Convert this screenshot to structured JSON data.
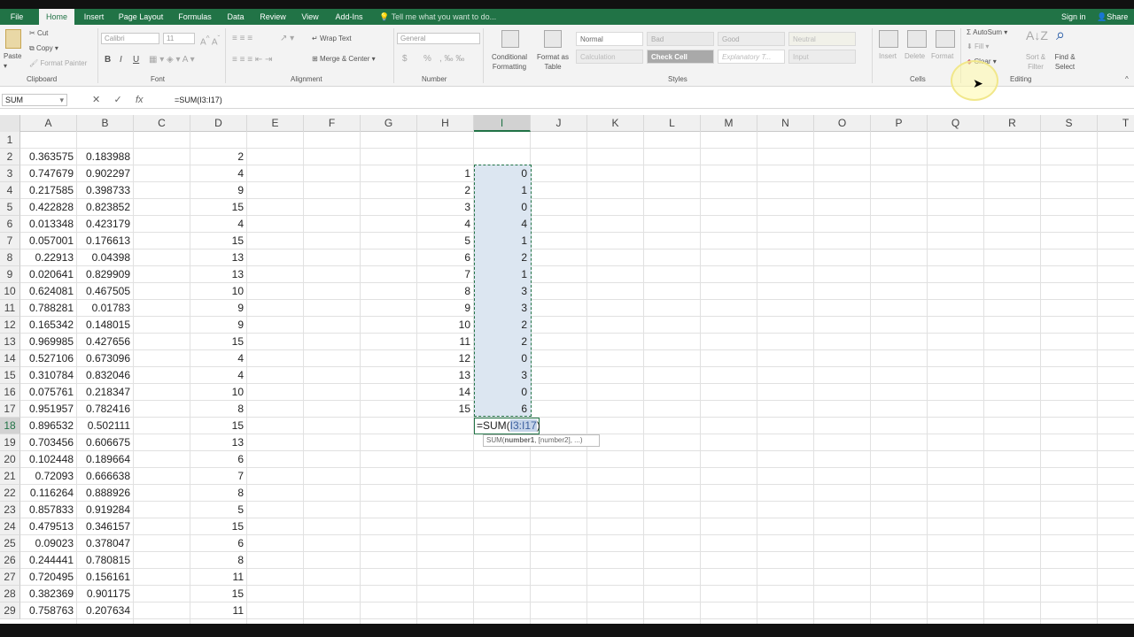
{
  "tabs": [
    "File",
    "Home",
    "Insert",
    "Page Layout",
    "Formulas",
    "Data",
    "Review",
    "View",
    "Add-Ins"
  ],
  "tell_me": "Tell me what you want to do...",
  "account": {
    "signin": "Sign in",
    "share": "Share"
  },
  "ribbon": {
    "clipboard": {
      "paste": "Paste",
      "cut": "Cut",
      "copy": "Copy",
      "format_painter": "Format Painter",
      "group": "Clipboard"
    },
    "font": {
      "name": "Calibri",
      "size": "11",
      "bold": "B",
      "italic": "I",
      "underline": "U",
      "group": "Font"
    },
    "alignment": {
      "wrap": "Wrap Text",
      "merge": "Merge & Center",
      "group": "Alignment"
    },
    "number": {
      "format": "General",
      "currency": "$",
      "percent": "%",
      "group": "Number"
    },
    "styles": {
      "conditional": "Conditional Formatting",
      "format_table": "Format as Table",
      "normal": "Normal",
      "bad": "Bad",
      "good": "Good",
      "neutral": "Neutral",
      "calculation": "Calculation",
      "check": "Check Cell",
      "explanatory": "Explanatory T...",
      "input": "Input",
      "group": "Styles"
    },
    "cells": {
      "insert": "Insert",
      "delete": "Delete",
      "format": "Format",
      "group": "Cells"
    },
    "editing": {
      "autosum": "AutoSum",
      "fill": "Fill",
      "clear": "Clear",
      "sort": "Sort & Filter",
      "find": "Find & Select",
      "group": "Editing"
    }
  },
  "formula_bar": {
    "name_box": "SUM",
    "formula": "=SUM(I3:I17)",
    "x": "✕",
    "check": "✓",
    "fx": "fx"
  },
  "columns": [
    "A",
    "B",
    "C",
    "D",
    "E",
    "F",
    "G",
    "H",
    "I",
    "J",
    "K",
    "L",
    "M",
    "N",
    "O",
    "P",
    "Q",
    "R",
    "S",
    "T"
  ],
  "rows": [
    1,
    2,
    3,
    4,
    5,
    6,
    7,
    8,
    9,
    10,
    11,
    12,
    13,
    14,
    15,
    16,
    17,
    18,
    19,
    20,
    21,
    22,
    23,
    24,
    25,
    26,
    27,
    28,
    29
  ],
  "col_a": [
    "",
    "0.363575",
    "0.747679",
    "0.217585",
    "0.422828",
    "0.013348",
    "0.057001",
    "0.22913",
    "0.020641",
    "0.624081",
    "0.788281",
    "0.165342",
    "0.969985",
    "0.527106",
    "0.310784",
    "0.075761",
    "0.951957",
    "0.896532",
    "0.703456",
    "0.102448",
    "0.72093",
    "0.116264",
    "0.857833",
    "0.479513",
    "0.09023",
    "0.244441",
    "0.720495",
    "0.382369",
    "0.758763"
  ],
  "col_b": [
    "",
    "0.183988",
    "0.902297",
    "0.398733",
    "0.823852",
    "0.423179",
    "0.176613",
    "0.04398",
    "0.829909",
    "0.467505",
    "0.01783",
    "0.148015",
    "0.427656",
    "0.673096",
    "0.832046",
    "0.218347",
    "0.782416",
    "0.502111",
    "0.606675",
    "0.189664",
    "0.666638",
    "0.888926",
    "0.919284",
    "0.346157",
    "0.378047",
    "0.780815",
    "0.156161",
    "0.901175",
    "0.207634"
  ],
  "col_d": [
    "",
    "2",
    "4",
    "9",
    "15",
    "4",
    "15",
    "13",
    "13",
    "10",
    "9",
    "9",
    "15",
    "4",
    "4",
    "10",
    "8",
    "15",
    "13",
    "6",
    "7",
    "8",
    "5",
    "15",
    "6",
    "8",
    "11",
    "15",
    "11"
  ],
  "col_h": [
    "",
    "",
    "1",
    "2",
    "3",
    "4",
    "5",
    "6",
    "7",
    "8",
    "9",
    "10",
    "11",
    "12",
    "13",
    "14",
    "15"
  ],
  "col_i": [
    "",
    "",
    "0",
    "1",
    "0",
    "4",
    "1",
    "2",
    "1",
    "3",
    "3",
    "2",
    "2",
    "0",
    "3",
    "0",
    "6"
  ],
  "edit_cell": {
    "prefix": "=SUM(",
    "ref": "I3:I17",
    "suffix": ")"
  },
  "tooltip": {
    "fn": "SUM(",
    "arg1": "number1",
    ",rest": ", [number2], ...)"
  }
}
